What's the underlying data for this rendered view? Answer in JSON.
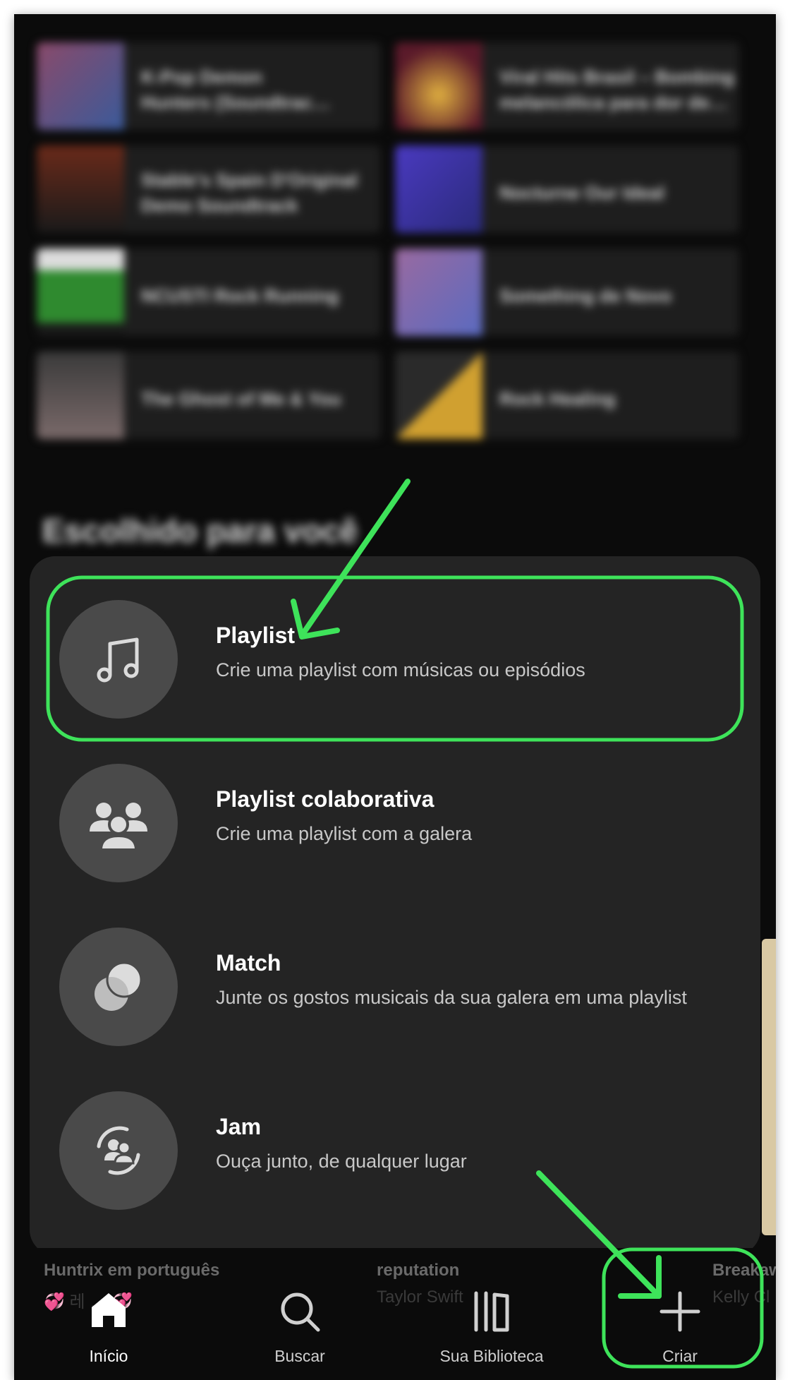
{
  "background": {
    "tiles": [
      {
        "line1": "K-Pop Demon",
        "line2": "Hunters (Soundtrac…",
        "color": "#6a3a5a"
      },
      {
        "line1": "Viral Hits Brasil – Bombing",
        "line2": "melancólica para dor de…",
        "color": "#5a2a1a"
      },
      {
        "line1": "Stable's Spain D'Original",
        "line2": "Demo Soundtrack",
        "color": "#3a1a1a"
      },
      {
        "line1": "Nocturne Our Ideal",
        "line2": "",
        "color": "#3a2a9a"
      },
      {
        "line1": "NCUSTI Rock Running",
        "line2": "",
        "color": "#2f8a2f"
      },
      {
        "line1": "Something de Novo",
        "line2": "",
        "color": "#6a4a6a"
      },
      {
        "line1": "The Ghost of Me & You",
        "line2": "",
        "color": "#3a3a3a"
      },
      {
        "line1": "Rock Healing",
        "line2": "",
        "color": "#6a5a2a"
      }
    ],
    "section_title": "Escolhido para você"
  },
  "sheet": {
    "options": [
      {
        "title": "Playlist",
        "subtitle": "Crie uma playlist com músicas ou episódios",
        "icon": "music-note-icon"
      },
      {
        "title": "Playlist colaborativa",
        "subtitle": "Crie uma playlist com a galera",
        "icon": "group-icon"
      },
      {
        "title": "Match",
        "subtitle": "Junte os gostos musicais da sua galera em uma playlist",
        "icon": "match-blend-icon"
      },
      {
        "title": "Jam",
        "subtitle": "Ouça junto, de qualquer lugar",
        "icon": "jam-icon"
      }
    ]
  },
  "peek": {
    "items": [
      {
        "title": "Huntrix em português",
        "subtitle": "💞 레 … 💞"
      },
      {
        "title": "reputation",
        "subtitle": "Taylor Swift"
      },
      {
        "title": "Breakaw",
        "subtitle": "Kelly Cl"
      }
    ]
  },
  "nav": {
    "items": [
      {
        "label": "Início",
        "icon": "home-icon"
      },
      {
        "label": "Buscar",
        "icon": "search-icon"
      },
      {
        "label": "Sua Biblioteca",
        "icon": "library-icon"
      },
      {
        "label": "Criar",
        "icon": "plus-icon"
      }
    ]
  },
  "colors": {
    "highlight": "#3ee35a",
    "sheet": "#242424",
    "icon_circle": "#4a4a4a"
  }
}
